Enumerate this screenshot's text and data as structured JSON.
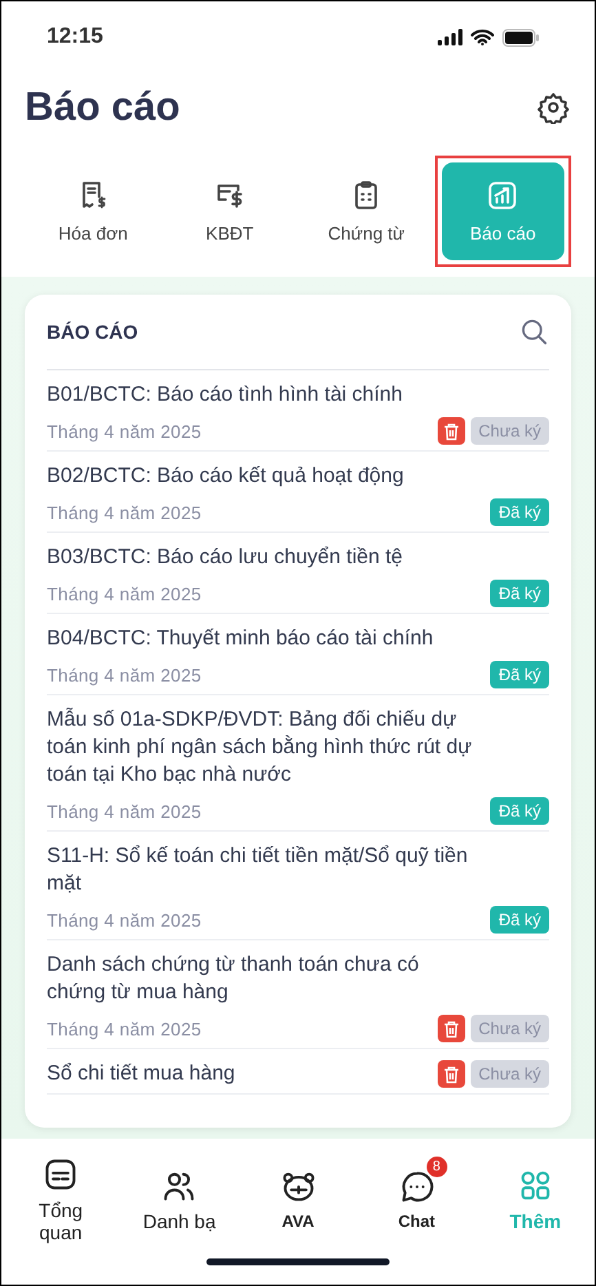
{
  "status_bar": {
    "time": "12:15"
  },
  "header": {
    "title": "Báo cáo"
  },
  "tabs": [
    {
      "label": "Hóa đơn",
      "selected": false,
      "highlighted": false
    },
    {
      "label": "KBĐT",
      "selected": false,
      "highlighted": false
    },
    {
      "label": "Chứng từ",
      "selected": false,
      "highlighted": false
    },
    {
      "label": "Báo cáo",
      "selected": true,
      "highlighted": true
    }
  ],
  "report_card": {
    "title": "BÁO CÁO",
    "items": [
      {
        "title": "B01/BCTC: Báo cáo tình hình tài chính",
        "date": "Tháng 4 năm 2025",
        "signed": false,
        "status": "Chưa ký",
        "deletable": true
      },
      {
        "title": "B02/BCTC: Báo cáo kết quả hoạt động",
        "date": "Tháng 4 năm 2025",
        "signed": true,
        "status": "Đã ký",
        "deletable": false
      },
      {
        "title": "B03/BCTC: Báo cáo lưu chuyển tiền tệ",
        "date": "Tháng 4 năm 2025",
        "signed": true,
        "status": "Đã ký",
        "deletable": false
      },
      {
        "title": "B04/BCTC: Thuyết minh báo cáo tài chính",
        "date": "Tháng 4 năm 2025",
        "signed": true,
        "status": "Đã ký",
        "deletable": false
      },
      {
        "title": "Mẫu số 01a-SDKP/ĐVDT: Bảng đối chiếu dự toán kinh phí ngân sách bằng hình thức rút dự toán tại Kho bạc nhà nước",
        "date": "Tháng 4 năm 2025",
        "signed": true,
        "status": "Đã ký",
        "deletable": false
      },
      {
        "title": "S11-H: Sổ kế toán chi tiết tiền mặt/Sổ quỹ tiền mặt",
        "date": "Tháng 4 năm 2025",
        "signed": true,
        "status": "Đã ký",
        "deletable": false
      },
      {
        "title": "Danh sách chứng từ thanh toán chưa có chứng từ mua hàng",
        "date": "Tháng 4 năm 2025",
        "signed": false,
        "status": "Chưa ký",
        "deletable": true
      },
      {
        "title": "Sổ chi tiết mua hàng",
        "signed": false,
        "status": "Chưa ký",
        "deletable": true
      }
    ]
  },
  "bottom_nav": [
    {
      "label": "Tổng quan",
      "selected": false
    },
    {
      "label": "Danh bạ",
      "selected": false
    },
    {
      "label": "AVA",
      "selected": false
    },
    {
      "label": "Chat",
      "selected": false,
      "badge": "8"
    },
    {
      "label": "Thêm",
      "selected": true
    }
  ]
}
